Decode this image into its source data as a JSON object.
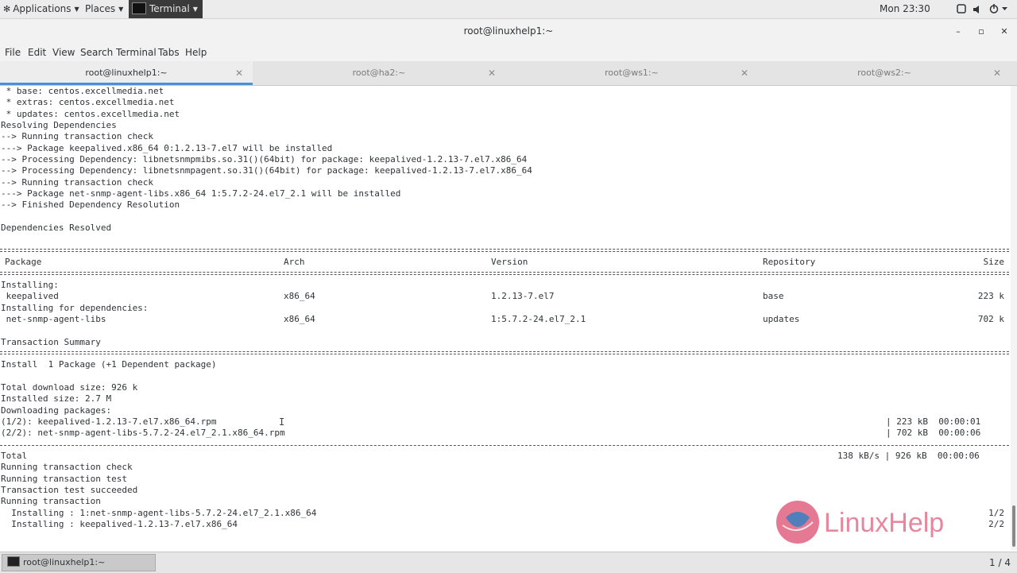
{
  "topbar": {
    "applications": "Applications",
    "places": "Places",
    "terminal": "Terminal",
    "clock": "Mon 23:30"
  },
  "window": {
    "title": "root@linuxhelp1:~",
    "minimize_icon": "minimize-icon",
    "maximize_icon": "maximize-icon",
    "close_icon": "close-icon"
  },
  "menu": [
    "File",
    "Edit",
    "View",
    "Search",
    "Terminal",
    "Tabs",
    "Help"
  ],
  "tabs": [
    {
      "label": "root@linuxhelp1:~",
      "active": true
    },
    {
      "label": "root@ha2:~",
      "active": false
    },
    {
      "label": "root@ws1:~",
      "active": false
    },
    {
      "label": "root@ws2:~",
      "active": false
    }
  ],
  "terminal_lines": [
    " * base: centos.excellmedia.net",
    " * extras: centos.excellmedia.net",
    " * updates: centos.excellmedia.net",
    "Resolving Dependencies",
    "--> Running transaction check",
    "---> Package keepalived.x86_64 0:1.2.13-7.el7 will be installed",
    "--> Processing Dependency: libnetsnmpmibs.so.31()(64bit) for package: keepalived-1.2.13-7.el7.x86_64",
    "--> Processing Dependency: libnetsnmpagent.so.31()(64bit) for package: keepalived-1.2.13-7.el7.x86_64",
    "--> Running transaction check",
    "---> Package net-snmp-agent-libs.x86_64 1:5.7.2-24.el7_2.1 will be installed",
    "--> Finished Dependency Resolution",
    "",
    "Dependencies Resolved"
  ],
  "table": {
    "headers": {
      "package": "Package",
      "arch": "Arch",
      "version": "Version",
      "repository": "Repository",
      "size": "Size"
    },
    "installing_label": "Installing:",
    "deps_label": "Installing for dependencies:",
    "rows": [
      {
        "package": " keepalived",
        "arch": "x86_64",
        "version": "1.2.13-7.el7",
        "repository": "base",
        "size": "223 k"
      },
      {
        "package": " net-snmp-agent-libs",
        "arch": "x86_64",
        "version": "1:5.7.2-24.el7_2.1",
        "repository": "updates",
        "size": "702 k"
      }
    ],
    "summary_title": "Transaction Summary"
  },
  "summary_lines": [
    "Install  1 Package (+1 Dependent package)",
    "",
    "Total download size: 926 k",
    "Installed size: 2.7 M",
    "Downloading packages:"
  ],
  "downloads": [
    {
      "name": "(1/2): keepalived-1.2.13-7.el7.x86_64.rpm",
      "stats": "| 223 kB  00:00:01"
    },
    {
      "name": "(2/2): net-snmp-agent-libs-5.7.2-24.el7_2.1.x86_64.rpm",
      "stats": "| 702 kB  00:00:06"
    }
  ],
  "total": {
    "label": "Total",
    "stats": "138 kB/s | 926 kB  00:00:06"
  },
  "run_lines": [
    "Running transaction check",
    "Running transaction test",
    "Transaction test succeeded",
    "Running transaction"
  ],
  "install_lines": [
    {
      "text": "  Installing : 1:net-snmp-agent-libs-5.7.2-24.el7_2.1.x86_64",
      "progress": "1/2"
    },
    {
      "text": "  Installing : keepalived-1.2.13-7.el7.x86_64",
      "progress": "2/2"
    }
  ],
  "watermark": "LinuxHelp",
  "bottombar": {
    "task_label": "root@linuxhelp1:~",
    "workspace": "1 / 4"
  },
  "colors": {
    "accent_tab": "#4a90d9",
    "logo_pink": "#e06080",
    "logo_blue": "#3f7fc0"
  }
}
